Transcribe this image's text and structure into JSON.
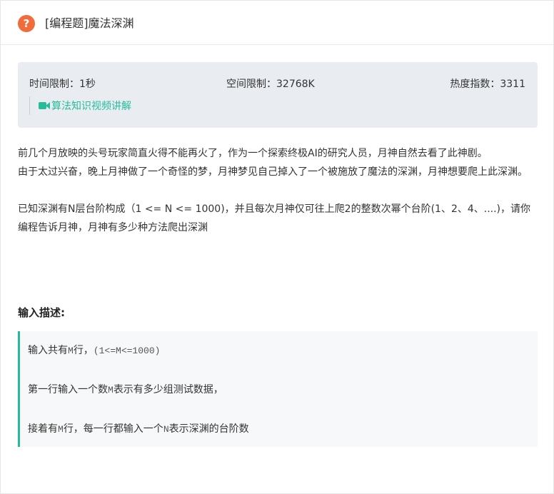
{
  "header": {
    "icon": "question-circle-icon",
    "icon_glyph": "?",
    "title": "[编程题]魔法深渊",
    "accent_color": "#f26b3a"
  },
  "limits": {
    "time": "时间限制：1秒",
    "space": "空间限制：32768K",
    "heat": "热度指数：3311"
  },
  "video_link": {
    "icon": "video-camera-icon",
    "label": "算法知识视频讲解",
    "color": "#25bb9b"
  },
  "description": {
    "p1": "前几个月放映的头号玩家简直火得不能再火了，作为一个探索终极AI的研究人员，月神自然去看了此神剧。",
    "p2": "由于太过兴奋，晚上月神做了一个奇怪的梦，月神梦见自己掉入了一个被施放了魔法的深渊，月神想要爬上此深渊。",
    "p3": "已知深渊有N层台阶构成（1 <= N <= 1000)，并且每次月神仅可往上爬2的整数次幂个台阶(1、2、4、....)，请你编程告诉月神，月神有多少种方法爬出深渊"
  },
  "input_section": {
    "title": "输入描述:",
    "line1_a": "输入共有",
    "line1_m": "M",
    "line1_b": "行，",
    "line1_range": "(1<=M<=1000)",
    "line2_a": "第一行输入一个数",
    "line2_m": "M",
    "line2_b": "表示有多少组测试数据，",
    "line3_a": "接着有",
    "line3_m": "M",
    "line3_b": "行，每一行都输入一个",
    "line3_n": "N",
    "line3_c": "表示深渊的台阶数"
  }
}
